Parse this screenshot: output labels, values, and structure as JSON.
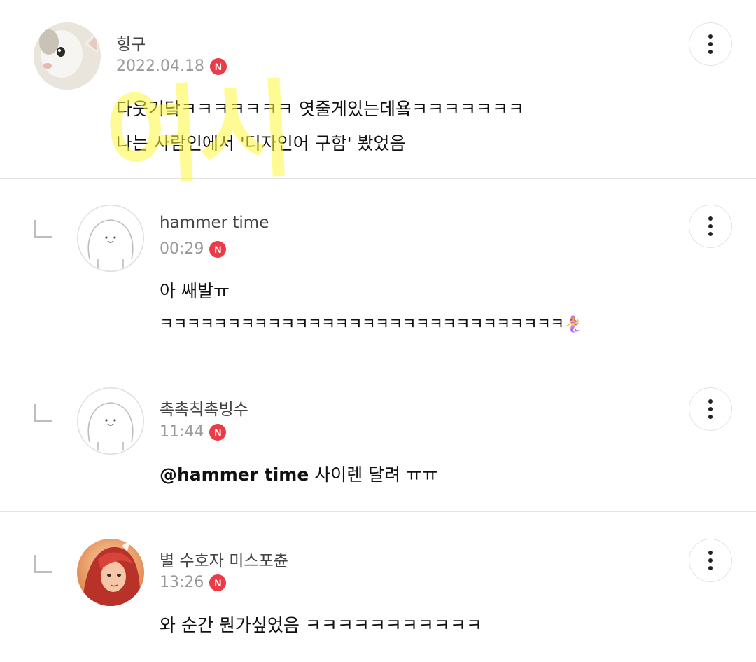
{
  "watermark": "여시",
  "comments": [
    {
      "name": "힝구",
      "time": "2022.04.18",
      "badge": "N",
      "lines": [
        "다웃기닼ㅋㅋㅋㅋㅋㅋㅋ 엿줄게있는데욬ㅋㅋㅋㅋㅋㅋㅋ",
        "나는 사람인에서 '디자인어 구함' 봤었음"
      ],
      "avatar": "cat-photo"
    },
    {
      "name": "hammer time",
      "time": "00:29",
      "badge": "N",
      "lines": [
        "아 쌔발ㅠ",
        "ㅋㅋㅋㅋㅋㅋㅋㅋㅋㅋㅋㅋㅋㅋㅋㅋㅋㅋㅋㅋㅋㅋㅋㅋㅋㅋㅋㅋㅋㅋ🧜‍♀️"
      ],
      "avatar": "default-seal"
    },
    {
      "name": "촉촉칙촉빙수",
      "time": "11:44",
      "badge": "N",
      "mention": "@hammer time",
      "lines": [
        " 사이렌 달려 ㅠㅠ"
      ],
      "avatar": "default-seal"
    },
    {
      "name": "별 수호자 미스포츈",
      "time": "13:26",
      "badge": "N",
      "lines": [
        "와 순간 뭔가싶었음 ㅋㅋㅋㅋㅋㅋㅋㅋㅋㅋㅋ"
      ],
      "avatar": "character-art"
    }
  ],
  "colors": {
    "badge": "#ea3b46",
    "divider": "#e3e3e3",
    "meta": "#9a9a9a"
  },
  "icons": {
    "more": "more-vertical-icon",
    "reply": "reply-corner-icon",
    "new": "new-badge-icon"
  }
}
